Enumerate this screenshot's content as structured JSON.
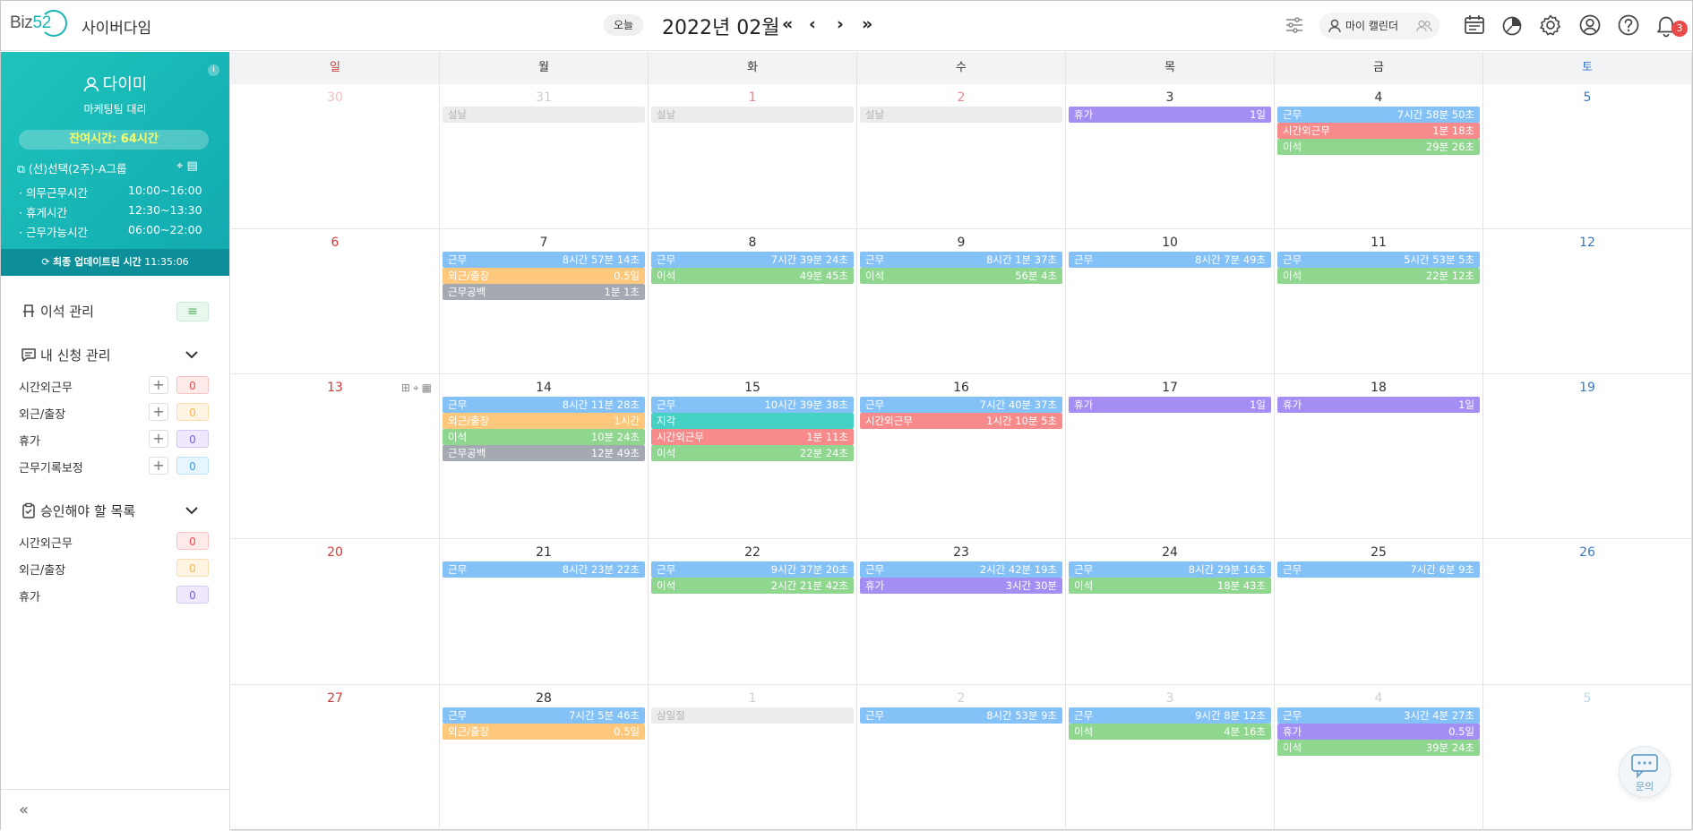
{
  "header": {
    "logo_text": "Biz",
    "logo_num": "52",
    "company": "사이버다임",
    "today_label": "오늘",
    "month_title": "2022년 02월",
    "my_calendar_label": "마이 캘린더",
    "notification_count": "3"
  },
  "profile": {
    "name": "다이미",
    "role": "마케팅팀 대리",
    "info": "i",
    "remaining": "잔여시간: 64시간",
    "group": "(선)선택(2주)-A그룹",
    "rows": [
      {
        "label": "· 의무근무시간",
        "value": "10:00~16:00"
      },
      {
        "label": "· 휴게시간",
        "value": "12:30~13:30"
      },
      {
        "label": "· 근무가능시간",
        "value": "06:00~22:00"
      }
    ],
    "last_update_label": "최종 업데이트된 시간",
    "last_update_time": "11:35:06"
  },
  "sidebar": {
    "away_title": "이석 관리",
    "my_requests_title": "내 신청 관리",
    "my_requests": [
      {
        "label": "시간외근무",
        "count": "0"
      },
      {
        "label": "외근/출장",
        "count": "0"
      },
      {
        "label": "휴가",
        "count": "0"
      },
      {
        "label": "근무기록보정",
        "count": "0"
      }
    ],
    "approvals_title": "승인해야 할 목록",
    "approvals": [
      {
        "label": "시간외근무",
        "count": "0"
      },
      {
        "label": "외근/출장",
        "count": "0"
      },
      {
        "label": "휴가",
        "count": "0"
      }
    ],
    "collapse_label": "«"
  },
  "calendar": {
    "weekdays": [
      "일",
      "월",
      "화",
      "수",
      "목",
      "금",
      "토"
    ],
    "weeks": [
      [
        "30",
        "31",
        "1",
        "2",
        "3",
        "4",
        "5"
      ],
      [
        "6",
        "7",
        "8",
        "9",
        "10",
        "11",
        "12"
      ],
      [
        "13",
        "14",
        "15",
        "16",
        "17",
        "18",
        "19"
      ],
      [
        "20",
        "21",
        "22",
        "23",
        "24",
        "25",
        "26"
      ],
      [
        "27",
        "28",
        "1",
        "2",
        "3",
        "4",
        "5"
      ]
    ],
    "events": {
      "w0": {
        "mon": [
          {
            "label": "설날",
            "time": ""
          }
        ],
        "tue": [
          {
            "label": "설날",
            "time": ""
          }
        ],
        "wed": [
          {
            "label": "설날",
            "time": ""
          }
        ],
        "thu": [
          {
            "label": "휴가",
            "time": "1일"
          }
        ],
        "fri": [
          {
            "label": "근무",
            "time": "7시간 58분 50초"
          },
          {
            "label": "시간외근무",
            "time": "1분 18초"
          },
          {
            "label": "이석",
            "time": "29분 26초"
          }
        ]
      },
      "w1": {
        "mon": [
          {
            "label": "근무",
            "time": "8시간 57분 14초"
          },
          {
            "label": "외근/출장",
            "time": "0.5일"
          },
          {
            "label": "근무공백",
            "time": "1분 1초"
          }
        ],
        "tue": [
          {
            "label": "근무",
            "time": "7시간 39분 24초"
          },
          {
            "label": "이석",
            "time": "49분 45초"
          }
        ],
        "wed": [
          {
            "label": "근무",
            "time": "8시간 1분 37초"
          },
          {
            "label": "이석",
            "time": "56분 4초"
          }
        ],
        "thu": [
          {
            "label": "근무",
            "time": "8시간 7분 49초"
          }
        ],
        "fri": [
          {
            "label": "근무",
            "time": "5시간 53분 5초"
          },
          {
            "label": "이석",
            "time": "22분 12초"
          }
        ]
      },
      "w2": {
        "mon": [
          {
            "label": "근무",
            "time": "8시간 11분 28초"
          },
          {
            "label": "외근/출장",
            "time": "1시간"
          },
          {
            "label": "이석",
            "time": "10분 24초"
          },
          {
            "label": "근무공백",
            "time": "12분 49초"
          }
        ],
        "tue": [
          {
            "label": "근무",
            "time": "10시간 39분 38초"
          },
          {
            "label": "지각",
            "time": ""
          },
          {
            "label": "시간외근무",
            "time": "1분 11초"
          },
          {
            "label": "이석",
            "time": "22분 24초"
          }
        ],
        "wed": [
          {
            "label": "근무",
            "time": "7시간 40분 37초"
          },
          {
            "label": "시간외근무",
            "time": "1시간 10분 5초"
          }
        ],
        "thu": [
          {
            "label": "휴가",
            "time": "1일"
          }
        ],
        "fri": [
          {
            "label": "휴가",
            "time": "1일"
          }
        ]
      },
      "w3": {
        "mon": [
          {
            "label": "근무",
            "time": "8시간 23분 22초"
          }
        ],
        "tue": [
          {
            "label": "근무",
            "time": "9시간 37분 20초"
          },
          {
            "label": "이석",
            "time": "2시간 21분 42초"
          }
        ],
        "wed": [
          {
            "label": "근무",
            "time": "2시간 42분 19초"
          },
          {
            "label": "휴가",
            "time": "3시간 30분"
          }
        ],
        "thu": [
          {
            "label": "근무",
            "time": "8시간 29분 16초"
          },
          {
            "label": "이석",
            "time": "18분 43초"
          }
        ],
        "fri": [
          {
            "label": "근무",
            "time": "7시간 6분 9초"
          }
        ]
      },
      "w4": {
        "mon": [
          {
            "label": "근무",
            "time": "7시간 5분 46초"
          },
          {
            "label": "외근/출장",
            "time": "0.5일"
          }
        ],
        "tue": [
          {
            "label": "삼일절",
            "time": ""
          }
        ],
        "wed": [
          {
            "label": "근무",
            "time": "8시간 53분 9초"
          }
        ],
        "thu": [
          {
            "label": "근무",
            "time": "9시간 8분 12초"
          },
          {
            "label": "이석",
            "time": "4분 16초"
          }
        ],
        "fri": [
          {
            "label": "근무",
            "time": "3시간 4분 27초"
          },
          {
            "label": "휴가",
            "time": "0.5일"
          },
          {
            "label": "이석",
            "time": "39분 24초"
          }
        ]
      }
    }
  },
  "chat": {
    "label": "문의"
  },
  "colors": {
    "accent": "#19b4b4",
    "work": "#84c1f7",
    "vacation": "#a48ef3",
    "overtime": "#f78b8b",
    "away": "#8fd68e",
    "outside": "#fdc77c",
    "blank": "#a5a9b2",
    "late": "#45d1c3"
  }
}
